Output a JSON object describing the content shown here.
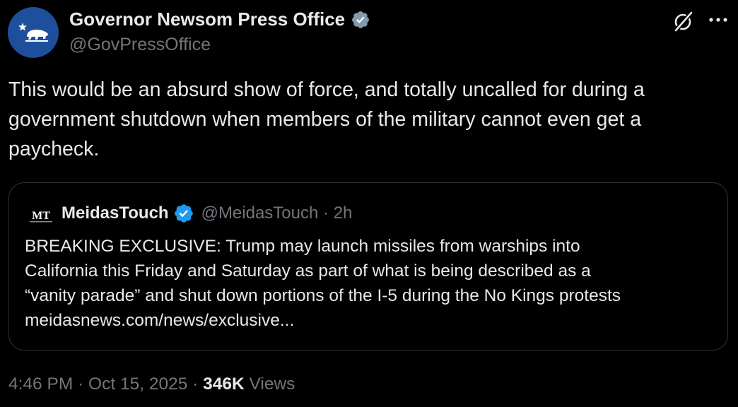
{
  "author": {
    "name": "Governor Newsom Press Office",
    "handle": "@GovPressOffice",
    "verified_color": "#829aab"
  },
  "tweet": {
    "text": "This would be an absurd show of force, and totally uncalled for during a\ngovernment shutdown when members of the military cannot even get a\npaycheck."
  },
  "quote": {
    "avatar_text": "MT",
    "name": "MeidasTouch",
    "verified_color": "#1d9bf0",
    "handle": "@MeidasTouch",
    "separator": " · ",
    "time": "2h",
    "text": "BREAKING EXCLUSIVE: Trump may launch missiles from warships into\nCalifornia this Friday and Saturday as part of what is being described as a\n“vanity parade” and shut down portions of the I-5 during the No Kings protests\nmeidasnews.com/news/exclusive..."
  },
  "footer": {
    "time": "4:46 PM",
    "separator1": " · ",
    "date": "Oct 15, 2025",
    "separator2": " · ",
    "views_count": "346K",
    "views_label": " Views"
  },
  "icons": {
    "grok": "grok-slash-icon",
    "more": "more-horizontal-icon",
    "verified": "verified-badge-icon",
    "avatar": "california-bear-icon"
  },
  "colors": {
    "background": "#000000",
    "primary_text": "#e7e9ea",
    "secondary_text": "#71767b",
    "border": "#2f3336",
    "avatar_bg": "#1d4f9c"
  }
}
